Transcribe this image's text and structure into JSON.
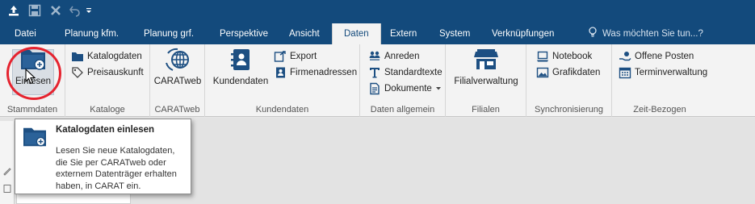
{
  "tabs": [
    "Datei",
    "Planung kfm.",
    "Planung grf.",
    "Perspektive",
    "Ansicht",
    "Daten",
    "Extern",
    "System",
    "Verknüpfungen"
  ],
  "active_tab": "Daten",
  "tell_me": "Was möchten Sie tun...?",
  "quick_access": [
    "upload-icon",
    "save-icon",
    "close-icon",
    "undo-icon",
    "customize-dropdown-icon"
  ],
  "groups": {
    "stammdaten": {
      "label": "Stammdaten",
      "einlesen": "Einlesen"
    },
    "kataloge": {
      "label": "Kataloge",
      "katalogdaten": "Katalogdaten",
      "preisauskunft": "Preisauskunft"
    },
    "caratweb": {
      "label": "CARATweb",
      "caratweb": "CARATweb"
    },
    "kundendaten": {
      "label": "Kundendaten",
      "kundendaten": "Kundendaten",
      "export": "Export",
      "firmenadressen": "Firmenadressen"
    },
    "daten_allgemein": {
      "label": "Daten allgemein",
      "anreden": "Anreden",
      "standardtexte": "Standardtexte",
      "dokumente": "Dokumente"
    },
    "filialen": {
      "label": "Filialen",
      "filialverwaltung": "Filialverwaltung"
    },
    "synchronisierung": {
      "label": "Synchronisierung",
      "notebook": "Notebook",
      "grafikdaten": "Grafikdaten"
    },
    "zeit_bezogen": {
      "label": "Zeit-Bezogen",
      "offene_posten": "Offene Posten",
      "terminverwaltung": "Terminverwaltung"
    }
  },
  "tooltip": {
    "title": "Katalogdaten einlesen",
    "body": "Lesen Sie neue Katalogdaten, die Sie per CARATweb oder externem Datenträger erhalten haben, in CARAT ein."
  },
  "colors": {
    "accent": "#134a7c",
    "highlight_ring": "#e5232f"
  }
}
